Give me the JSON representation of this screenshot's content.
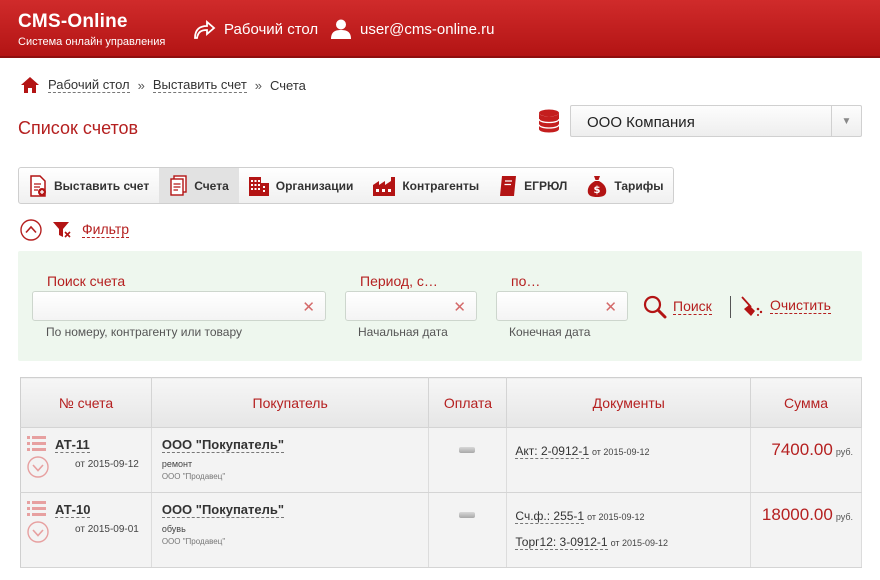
{
  "header": {
    "brand_title": "CMS-Online",
    "brand_subtitle": "Система онлайн управления",
    "desk_link": "Рабочий стол",
    "user_email": "user@cms-online.ru"
  },
  "breadcrumb": {
    "items": [
      "Рабочий стол",
      "Выставить счет",
      "Счета"
    ],
    "separator": "»"
  },
  "page_title": "Список счетов",
  "company_select": {
    "value": "ООО Компания"
  },
  "toolbar": {
    "items": [
      {
        "label": "Выставить счет",
        "icon": "invoice-add-icon"
      },
      {
        "label": "Счета",
        "icon": "documents-icon",
        "active": true
      },
      {
        "label": "Организации",
        "icon": "building-icon"
      },
      {
        "label": "Контрагенты",
        "icon": "factory-icon"
      },
      {
        "label": "ЕГРЮЛ",
        "icon": "registry-book-icon"
      },
      {
        "label": "Тарифы",
        "icon": "money-bag-icon"
      }
    ]
  },
  "filter": {
    "toggle_label": "Фильтр",
    "search_label": "Поиск счета",
    "search_value": "",
    "search_hint": "По номеру, контрагенту или товару",
    "period_from_label": "Период, с…",
    "period_from_value": "",
    "period_from_hint": "Начальная дата",
    "period_to_label": "по…",
    "period_to_value": "",
    "period_to_hint": "Конечная дата",
    "search_button": "Поиск",
    "clear_button": "Очистить"
  },
  "table": {
    "columns": [
      "№ счета",
      "Покупатель",
      "Оплата",
      "Документы",
      "Сумма"
    ],
    "rows": [
      {
        "number": "АТ-11",
        "date": "от 2015-09-12",
        "buyer": "ООО \"Покупатель\"",
        "note": "ремонт",
        "seller": "ООО \"Продавец\"",
        "docs": [
          {
            "label": "Акт: 2-0912-1",
            "date": "от 2015-09-12"
          }
        ],
        "amount": "7400.00",
        "currency": "руб."
      },
      {
        "number": "АТ-10",
        "date": "от 2015-09-01",
        "buyer": "ООО \"Покупатель\"",
        "note": "обувь",
        "seller": "ООО \"Продавец\"",
        "docs": [
          {
            "label": "Сч.ф.: 255-1",
            "date": "от 2015-09-12"
          },
          {
            "label": "Торг12: 3-0912-1",
            "date": "от 2015-09-12"
          }
        ],
        "amount": "18000.00",
        "currency": "руб."
      }
    ]
  },
  "colors": {
    "brand_red": "#c41e1e",
    "accent_text": "#b52020",
    "filter_bg": "#eef7ee"
  }
}
